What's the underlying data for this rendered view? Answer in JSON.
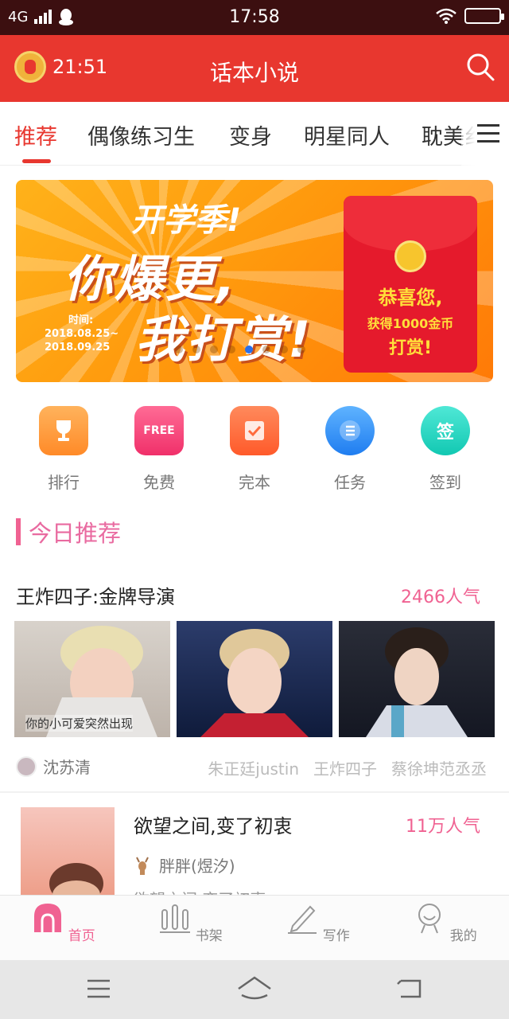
{
  "status_bar": {
    "network": "4G",
    "time": "17:58"
  },
  "app_bar": {
    "clock_time": "21:51",
    "title": "话本小说"
  },
  "tabs": [
    {
      "label": "推荐",
      "active": true
    },
    {
      "label": "偶像练习生"
    },
    {
      "label": "变身"
    },
    {
      "label": "明星同人"
    },
    {
      "label": "耽美纟"
    }
  ],
  "banner": {
    "headline": "开学季!",
    "line1": "你爆更,",
    "line2": "我打赏!",
    "date_label": "时间:",
    "date_start": "2018.08.25~",
    "date_end": "2018.09.25",
    "envelope_line1": "恭喜您,",
    "envelope_line2": "获得1000金币",
    "envelope_line3": "打赏!",
    "carousel_index": 5,
    "carousel_count": 8
  },
  "categories": [
    {
      "label": "排行",
      "icon": "trophy-icon",
      "color": "#ff9b3c"
    },
    {
      "label": "免费",
      "icon": "free-sign-icon",
      "color": "#f5467a",
      "icon_text": "FREE"
    },
    {
      "label": "完本",
      "icon": "check-book-icon",
      "color": "#ff6a3d"
    },
    {
      "label": "任务",
      "icon": "list-icon",
      "color": "#2e8cf5"
    },
    {
      "label": "签到",
      "icon": "sign-in-icon",
      "color": "#22d6c2",
      "icon_text": "签"
    }
  ],
  "section": {
    "title": "今日推荐"
  },
  "card1": {
    "title": "王炸四子:金牌导演",
    "popularity": "2466人气",
    "image_caption": "你的小可爱突然出现",
    "author": "沈苏清",
    "tags": [
      "朱正廷justin",
      "王炸四子",
      "蔡徐坤范丞丞"
    ]
  },
  "card2": {
    "title": "欲望之间,变了初衷",
    "popularity": "11万人气",
    "author": "胖胖(煜汐)",
    "desc": "欲望之间,变了初衷"
  },
  "bottom_nav": [
    {
      "label": "首页",
      "icon": "home-icon",
      "active": true
    },
    {
      "label": "书架",
      "icon": "bookshelf-icon"
    },
    {
      "label": "写作",
      "icon": "pencil-icon"
    },
    {
      "label": "我的",
      "icon": "profile-icon"
    }
  ],
  "colors": {
    "brand": "#e8372f",
    "accent_pink": "#f06292"
  }
}
